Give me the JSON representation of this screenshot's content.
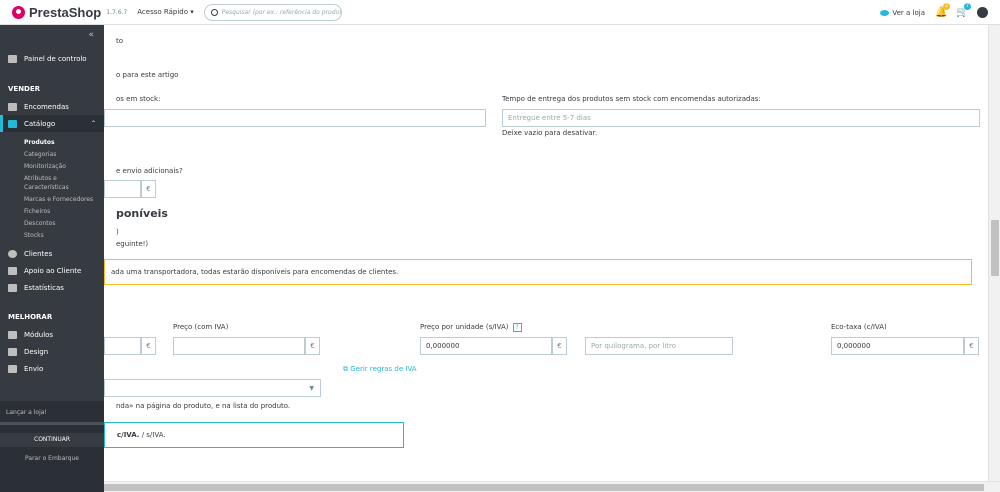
{
  "topbar": {
    "logo": "PrestaShop",
    "version": "1.7.6.7",
    "quick_access": "Acesso Rápido ▾",
    "search_placeholder": "Pesquisar (por ex.: referência do produt",
    "view_shop": "Ver a loja",
    "notif_badge_1": "2",
    "notif_badge_2": "7"
  },
  "sidebar": {
    "dashboard": "Painel de controlo",
    "sell_section": "VENDER",
    "orders": "Encomendas",
    "catalog": "Catálogo",
    "catalog_sub": [
      "Produtos",
      "Categorias",
      "Monitorização",
      "Atributos e Características",
      "Marcas e Fornecedores",
      "Ficheiros",
      "Descontos",
      "Stocks"
    ],
    "customers": "Clientes",
    "support": "Apoio ao Cliente",
    "stats": "Estatísticas",
    "improve_section": "MELHORAR",
    "modules": "Módulos",
    "design": "Design",
    "shipping": "Envio"
  },
  "onboarding": {
    "label": "Lançar a loja!",
    "continue": "CONTINUAR",
    "stop": "Parar o Embarque"
  },
  "form": {
    "text_cut_1": "to",
    "text_cut_2": "o para este artigo",
    "in_stock_label": "os em stock:",
    "out_stock_label": "Tempo de entrega dos produtos sem stock com encomendas autorizadas:",
    "out_stock_placeholder": "Entregue entre 5-7 dias",
    "out_stock_help": "Deixe vazio para desativar.",
    "extra_shipping_label": "e envio adicionais?",
    "currency": "€",
    "carriers_heading": "poníveis",
    "carriers_line1": ")",
    "carriers_line2": "eguinte!)",
    "carriers_alert": "ada uma transportadora, todas estarão disponíveis para encomendas de clientes.",
    "price_incl_label": "Preço (com IVA)",
    "unit_price_label": "Preço por unidade (s/IVA)",
    "help_icon": "?",
    "unit_price_value": "0,000000",
    "unit_placeholder": "Por quilograma, por litro",
    "ecotax_label": "Eco-taxa (c/IVA)",
    "ecotax_value": "0,000000",
    "tax_rules_link": "Gerir regras de IVA",
    "display_note": "nda» na página do produto, e na lista do produto.",
    "info_bold": "c/IVA.",
    "info_rest": " / s/IVA."
  }
}
